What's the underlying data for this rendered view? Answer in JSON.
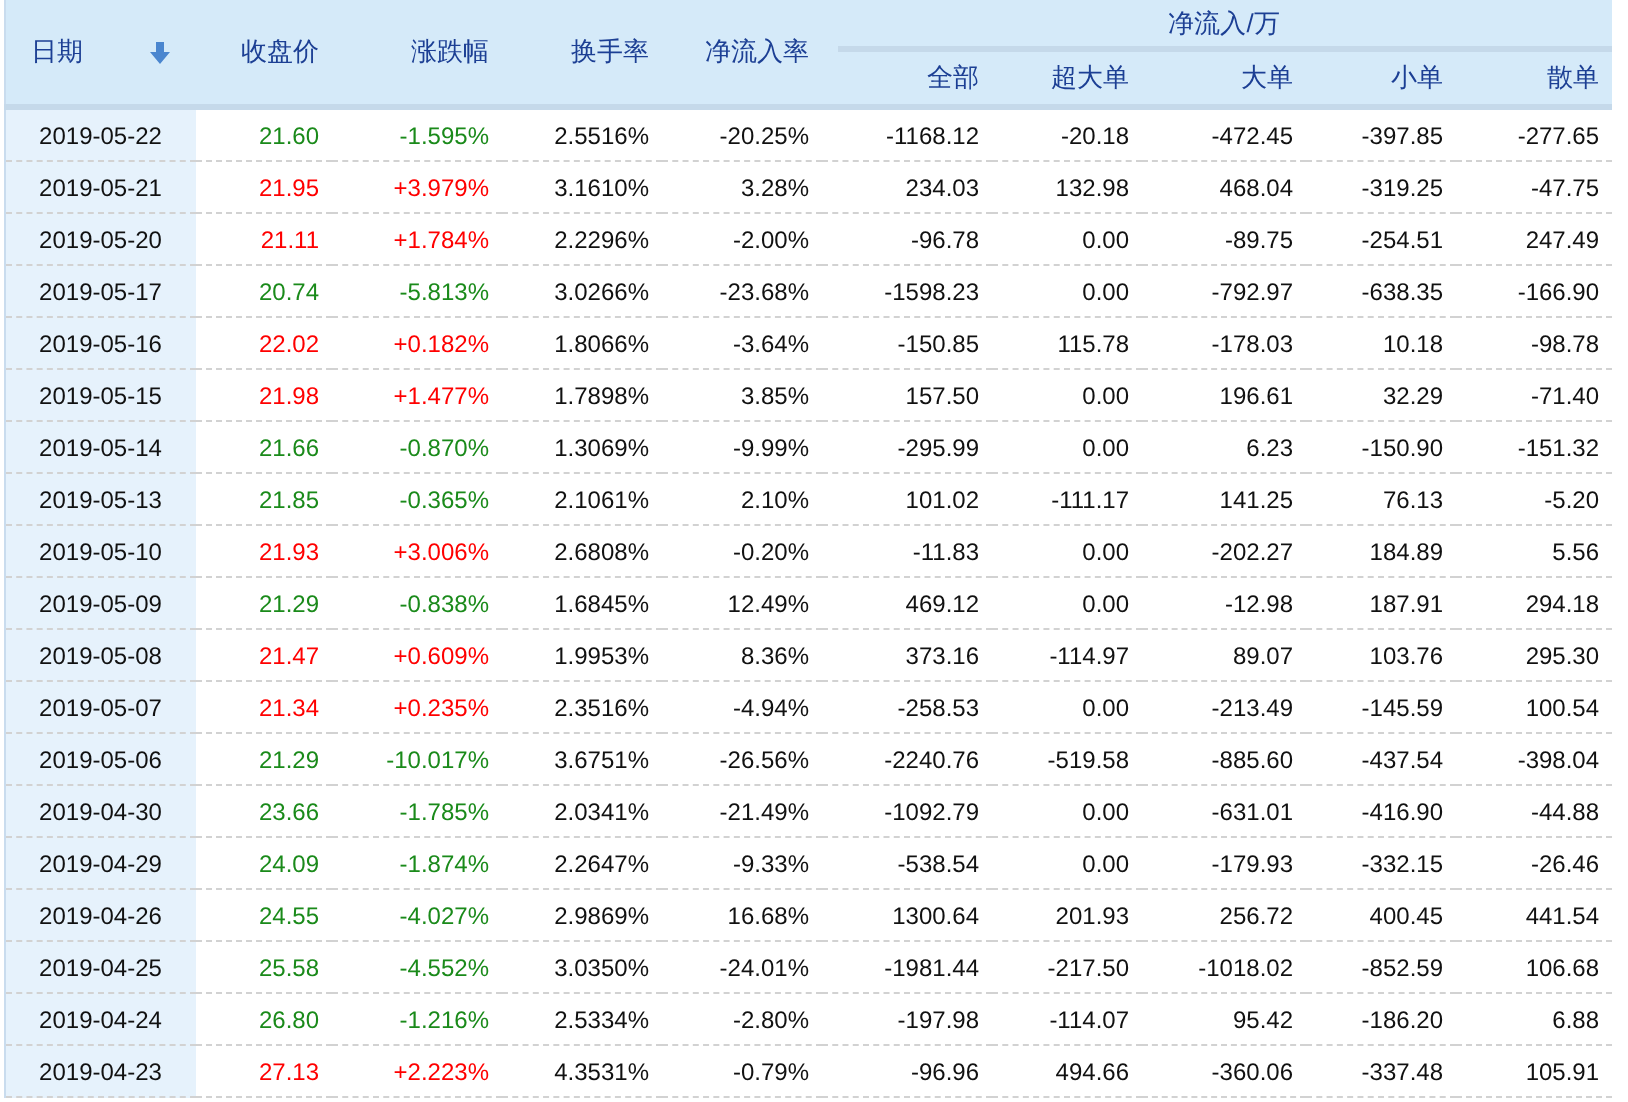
{
  "table": {
    "columns": [
      {
        "label": "日期",
        "sorted": true
      },
      {
        "label": "收盘价",
        "sorted": false
      },
      {
        "label": "涨跌幅",
        "sorted": false
      },
      {
        "label": "换手率",
        "sorted": false
      },
      {
        "label": "净流入率",
        "sorted": false
      }
    ],
    "group_header": "净流入/万",
    "subcolumns": [
      "全部",
      "超大单",
      "大单",
      "小单",
      "散单"
    ],
    "rows": [
      {
        "color": "#1a8a1a",
        "values": [
          "2019-05-22",
          "21.60",
          "-1.595%",
          "2.5516%",
          "-20.25%",
          "-1168.12",
          "-20.18",
          "-472.45",
          "-397.85",
          "-277.65"
        ]
      },
      {
        "color": "#ff0000",
        "values": [
          "2019-05-21",
          "21.95",
          "+3.979%",
          "3.1610%",
          "3.28%",
          "234.03",
          "132.98",
          "468.04",
          "-319.25",
          "-47.75"
        ]
      },
      {
        "color": "#ff0000",
        "values": [
          "2019-05-20",
          "21.11",
          "+1.784%",
          "2.2296%",
          "-2.00%",
          "-96.78",
          "0.00",
          "-89.75",
          "-254.51",
          "247.49"
        ]
      },
      {
        "color": "#1a8a1a",
        "values": [
          "2019-05-17",
          "20.74",
          "-5.813%",
          "3.0266%",
          "-23.68%",
          "-1598.23",
          "0.00",
          "-792.97",
          "-638.35",
          "-166.90"
        ]
      },
      {
        "color": "#ff0000",
        "values": [
          "2019-05-16",
          "22.02",
          "+0.182%",
          "1.8066%",
          "-3.64%",
          "-150.85",
          "115.78",
          "-178.03",
          "10.18",
          "-98.78"
        ]
      },
      {
        "color": "#ff0000",
        "values": [
          "2019-05-15",
          "21.98",
          "+1.477%",
          "1.7898%",
          "3.85%",
          "157.50",
          "0.00",
          "196.61",
          "32.29",
          "-71.40"
        ]
      },
      {
        "color": "#1a8a1a",
        "values": [
          "2019-05-14",
          "21.66",
          "-0.870%",
          "1.3069%",
          "-9.99%",
          "-295.99",
          "0.00",
          "6.23",
          "-150.90",
          "-151.32"
        ]
      },
      {
        "color": "#1a8a1a",
        "values": [
          "2019-05-13",
          "21.85",
          "-0.365%",
          "2.1061%",
          "2.10%",
          "101.02",
          "-111.17",
          "141.25",
          "76.13",
          "-5.20"
        ]
      },
      {
        "color": "#ff0000",
        "values": [
          "2019-05-10",
          "21.93",
          "+3.006%",
          "2.6808%",
          "-0.20%",
          "-11.83",
          "0.00",
          "-202.27",
          "184.89",
          "5.56"
        ]
      },
      {
        "color": "#1a8a1a",
        "values": [
          "2019-05-09",
          "21.29",
          "-0.838%",
          "1.6845%",
          "12.49%",
          "469.12",
          "0.00",
          "-12.98",
          "187.91",
          "294.18"
        ]
      },
      {
        "color": "#ff0000",
        "values": [
          "2019-05-08",
          "21.47",
          "+0.609%",
          "1.9953%",
          "8.36%",
          "373.16",
          "-114.97",
          "89.07",
          "103.76",
          "295.30"
        ]
      },
      {
        "color": "#ff0000",
        "values": [
          "2019-05-07",
          "21.34",
          "+0.235%",
          "2.3516%",
          "-4.94%",
          "-258.53",
          "0.00",
          "-213.49",
          "-145.59",
          "100.54"
        ]
      },
      {
        "color": "#1a8a1a",
        "values": [
          "2019-05-06",
          "21.29",
          "-10.017%",
          "3.6751%",
          "-26.56%",
          "-2240.76",
          "-519.58",
          "-885.60",
          "-437.54",
          "-398.04"
        ]
      },
      {
        "color": "#1a8a1a",
        "values": [
          "2019-04-30",
          "23.66",
          "-1.785%",
          "2.0341%",
          "-21.49%",
          "-1092.79",
          "0.00",
          "-631.01",
          "-416.90",
          "-44.88"
        ]
      },
      {
        "color": "#1a8a1a",
        "values": [
          "2019-04-29",
          "24.09",
          "-1.874%",
          "2.2647%",
          "-9.33%",
          "-538.54",
          "0.00",
          "-179.93",
          "-332.15",
          "-26.46"
        ]
      },
      {
        "color": "#1a8a1a",
        "values": [
          "2019-04-26",
          "24.55",
          "-4.027%",
          "2.9869%",
          "16.68%",
          "1300.64",
          "201.93",
          "256.72",
          "400.45",
          "441.54"
        ]
      },
      {
        "color": "#1a8a1a",
        "values": [
          "2019-04-25",
          "25.58",
          "-4.552%",
          "3.0350%",
          "-24.01%",
          "-1981.44",
          "-217.50",
          "-1018.02",
          "-852.59",
          "106.68"
        ]
      },
      {
        "color": "#1a8a1a",
        "values": [
          "2019-04-24",
          "26.80",
          "-1.216%",
          "2.5334%",
          "-2.80%",
          "-197.98",
          "-114.07",
          "95.42",
          "-186.20",
          "6.88"
        ]
      },
      {
        "color": "#ff0000",
        "values": [
          "2019-04-23",
          "27.13",
          "+2.223%",
          "4.3531%",
          "-0.79%",
          "-96.96",
          "494.66",
          "-360.06",
          "-337.48",
          "105.91"
        ]
      }
    ]
  }
}
